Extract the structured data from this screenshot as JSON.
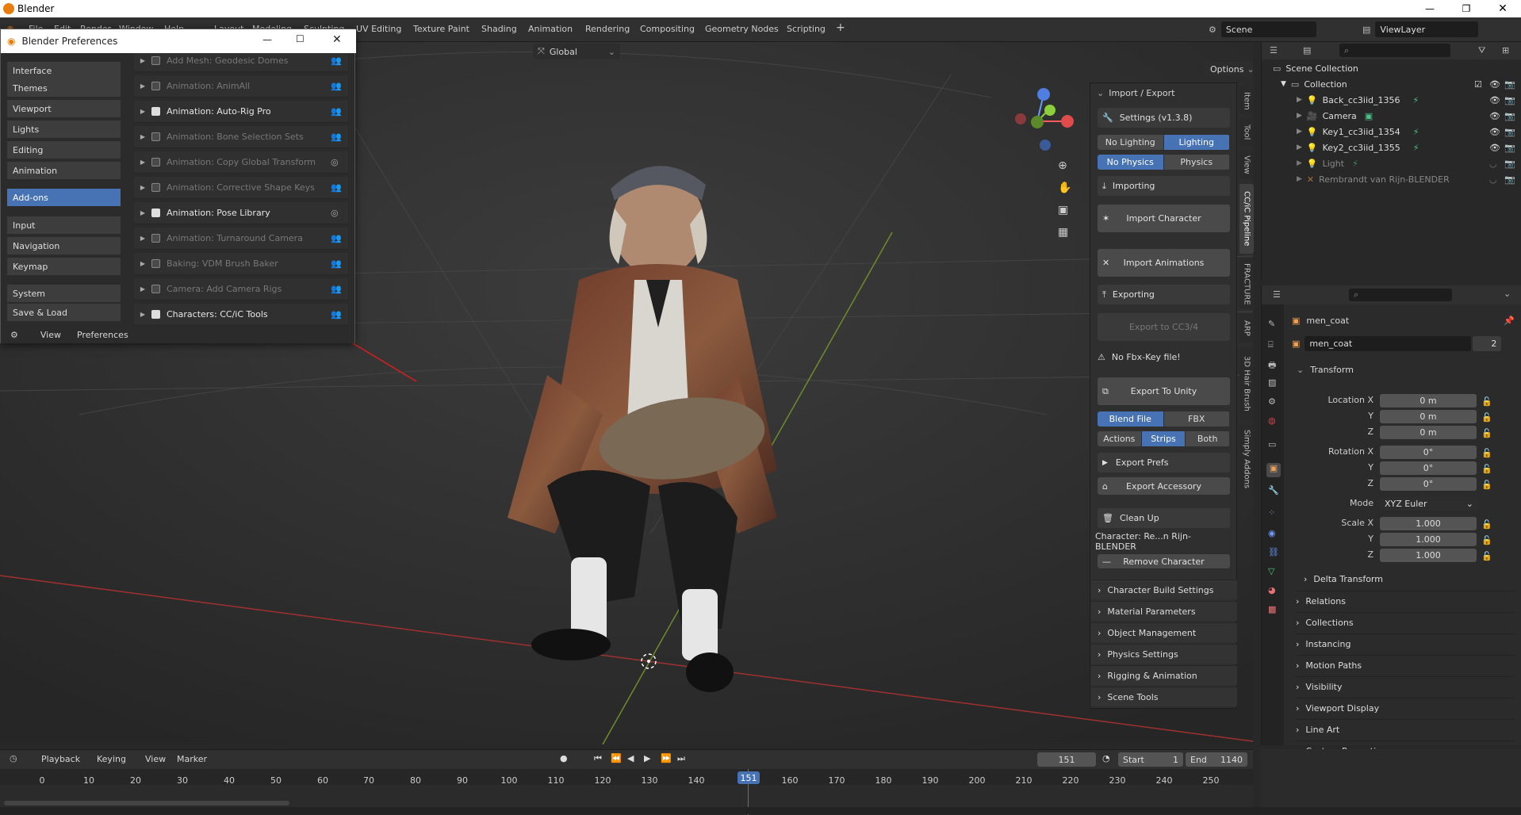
{
  "os": {
    "title": "Blender"
  },
  "menu": {
    "items": [
      "File",
      "Edit",
      "Render",
      "Window",
      "Help"
    ],
    "workspaces": [
      "Layout",
      "Modeling",
      "Sculpting",
      "UV Editing",
      "Texture Paint",
      "Shading",
      "Animation",
      "Rendering",
      "Compositing",
      "Geometry Nodes",
      "Scripting"
    ],
    "add_tab": "+"
  },
  "scene": {
    "label": "Scene"
  },
  "view_layer": {
    "label": "ViewLayer"
  },
  "viewport": {
    "orientation": "Global",
    "options_label": "Options"
  },
  "prefs": {
    "title": "Blender Preferences",
    "categories": [
      {
        "label": "Interface"
      },
      {
        "label": "Themes"
      },
      {
        "label": "Viewport"
      },
      {
        "label": "Lights"
      },
      {
        "label": "Editing"
      },
      {
        "label": "Animation"
      },
      {
        "label": "Add-ons"
      },
      {
        "label": "Input"
      },
      {
        "label": "Navigation"
      },
      {
        "label": "Keymap"
      },
      {
        "label": "System"
      },
      {
        "label": "Save & Load"
      }
    ],
    "addons": [
      {
        "name": "Add Mesh: Geodesic Domes",
        "enabled": false
      },
      {
        "name": "Animation: AnimAll",
        "enabled": false
      },
      {
        "name": "Animation: Auto-Rig Pro",
        "enabled": true
      },
      {
        "name": "Animation: Bone Selection Sets",
        "enabled": false
      },
      {
        "name": "Animation: Copy Global Transform",
        "enabled": false
      },
      {
        "name": "Animation: Corrective Shape Keys",
        "enabled": false
      },
      {
        "name": "Animation: Pose Library",
        "enabled": true
      },
      {
        "name": "Animation: Turnaround Camera",
        "enabled": false
      },
      {
        "name": "Baking: VDM Brush Baker",
        "enabled": false
      },
      {
        "name": "Camera: Add Camera Rigs",
        "enabled": false
      },
      {
        "name": "Characters: CC/iC Tools",
        "enabled": true
      }
    ],
    "footer": {
      "view": "View",
      "preferences": "Preferences"
    }
  },
  "npanel": {
    "header": "Import / Export",
    "settings": "Settings  (v1.3.8)",
    "lighting": [
      "No Lighting",
      "Lighting"
    ],
    "physics": [
      "No Physics",
      "Physics"
    ],
    "importing": "Importing",
    "import_character": "Import Character",
    "import_animations": "Import Animations",
    "exporting": "Exporting",
    "export_cc": "Export to CC3/4",
    "warning": "No Fbx-Key file!",
    "export_unity": "Export To Unity",
    "format": [
      "Blend File",
      "FBX"
    ],
    "mode": [
      "Actions",
      "Strips",
      "Both"
    ],
    "export_prefs": "Export Prefs",
    "export_accessory": "Export Accessory",
    "clean_up": "Clean Up",
    "character": "Character: Re...n Rijn-BLENDER",
    "remove": "Remove Character",
    "sections": [
      "Character Build Settings",
      "Material Parameters",
      "Object Management",
      "Physics Settings",
      "Rigging & Animation",
      "Scene Tools"
    ],
    "tabs": [
      "Item",
      "Tool",
      "View",
      "CC/iC Pipeline",
      "FRACTURE",
      "ARP",
      "3D Hair Brush",
      "Simply Addons"
    ]
  },
  "outliner": {
    "root": "Scene Collection",
    "collection": "Collection",
    "items": [
      {
        "name": "Back_cc3iid_1356",
        "dim": false
      },
      {
        "name": "Camera",
        "dim": false
      },
      {
        "name": "Key1_cc3iid_1354",
        "dim": false
      },
      {
        "name": "Key2_cc3iid_1355",
        "dim": false
      },
      {
        "name": "Light",
        "dim": true
      },
      {
        "name": "Rembrandt van Rijn-BLENDER",
        "dim": true
      }
    ]
  },
  "props": {
    "object_name": "men_coat",
    "data_name": "men_coat",
    "users": "2",
    "transform": "Transform",
    "location": {
      "label": "Location X",
      "x": "0 m",
      "y": "0 m",
      "z": "0 m"
    },
    "rotation": {
      "label": "Rotation X",
      "x": "0°",
      "y": "0°",
      "z": "0°"
    },
    "mode_label": "Mode",
    "mode": "XYZ Euler",
    "scale": {
      "label": "Scale X",
      "x": "1.000",
      "y": "1.000",
      "z": "1.000"
    },
    "axis": {
      "y": "Y",
      "z": "Z"
    },
    "delta": "Delta Transform",
    "sections": [
      "Relations",
      "Collections",
      "Instancing",
      "Motion Paths",
      "Visibility",
      "Viewport Display",
      "Line Art",
      "Custom Properties"
    ]
  },
  "timeline": {
    "menus": [
      "Playback",
      "Keying",
      "View",
      "Marker"
    ],
    "current": "151",
    "start_label": "Start",
    "start": "1",
    "end_label": "End",
    "end": "1140",
    "ticks": [
      "0",
      "10",
      "20",
      "30",
      "40",
      "50",
      "60",
      "70",
      "80",
      "90",
      "100",
      "110",
      "120",
      "130",
      "140",
      "150",
      "160",
      "170",
      "180",
      "190",
      "200",
      "210",
      "220",
      "230",
      "240",
      "250"
    ],
    "current_frame_label": "151"
  },
  "colors": {
    "accent": "#4772b3",
    "annotation": "#d42020"
  }
}
